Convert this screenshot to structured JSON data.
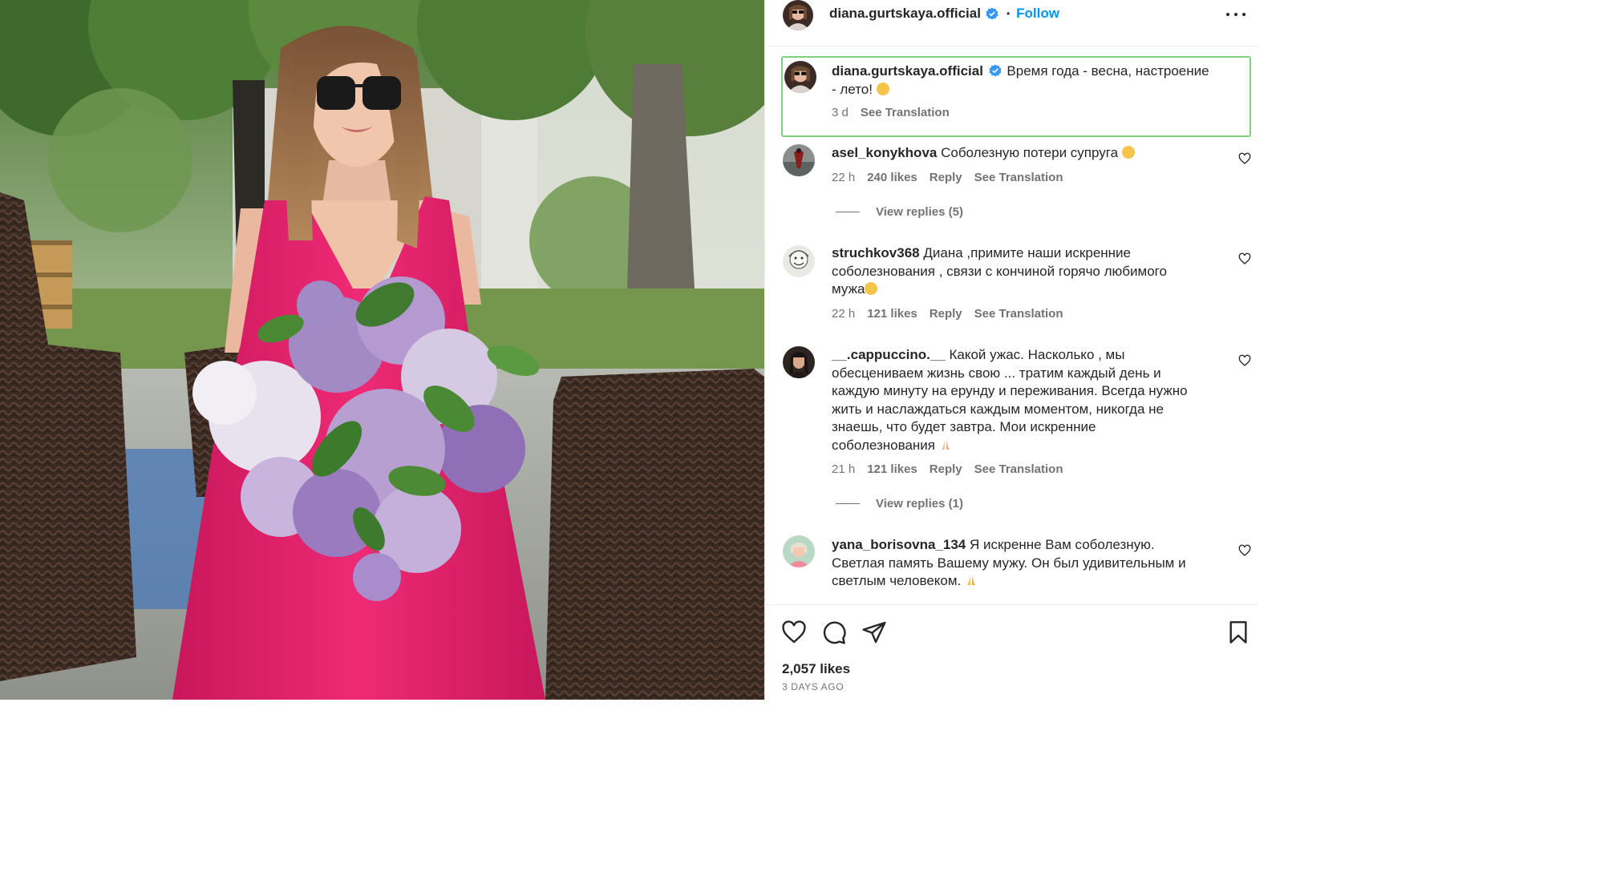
{
  "post": {
    "author": "diana.gurtskaya.official",
    "follow_label": "Follow",
    "separator": "•",
    "more_label": "•••",
    "caption": {
      "username": "diana.gurtskaya.official",
      "text_line1": "Время года - весна, настроение",
      "text_line2": "- лето!",
      "time": "3 d",
      "see_translation": "See Translation",
      "highlight_color": "#7ed37a"
    }
  },
  "comments": [
    {
      "username": "asel_konykhova",
      "text": "Соболезную потери супруга",
      "time": "22 h",
      "likes": "240 likes",
      "reply": "Reply",
      "see_translation": "See Translation",
      "view_replies": "View replies (5)"
    },
    {
      "username": "struchkov368",
      "text_line1": "Диана ,примите наши искренние",
      "text_line2": "соболезнования , связи с кончиной горячо любимого",
      "text_line3": "мужа",
      "time": "22 h",
      "likes": "121 likes",
      "reply": "Reply",
      "see_translation": "See Translation"
    },
    {
      "username": "__.cappuccino.__",
      "text_line1": "Какой ужас. Насколько , мы",
      "text_line2": "обесцениваем жизнь свою ... тратим каждый день и",
      "text_line3": "каждую минуту на ерунду и переживания. Всегда нужно",
      "text_line4": "жить и наслаждаться каждым моментом, никогда не",
      "text_line5": "знаешь, что будет завтра. Мои искренние",
      "text_line6": "соболезнования",
      "time": "21 h",
      "likes": "121 likes",
      "reply": "Reply",
      "see_translation": "See Translation",
      "view_replies": "View replies (1)"
    },
    {
      "username": "yana_borisovna_134",
      "text_line1": "Я искренне Вам соболезную.",
      "text_line2": "Светлая память Вашему мужу. Он был удивительным и",
      "text_line3": "светлым человеком."
    }
  ],
  "footer": {
    "likes": "2,057 likes",
    "date": "3 DAYS AGO"
  },
  "icons": {
    "like": "heart-icon",
    "comment": "comment-icon",
    "share": "paper-plane-icon",
    "save": "bookmark-icon",
    "verified": "verified-badge-icon",
    "more": "more-options-icon"
  },
  "colors": {
    "accent": "#0095f6",
    "verified": "#3897f0",
    "dress": "#e0246a",
    "muted": "#737373"
  }
}
